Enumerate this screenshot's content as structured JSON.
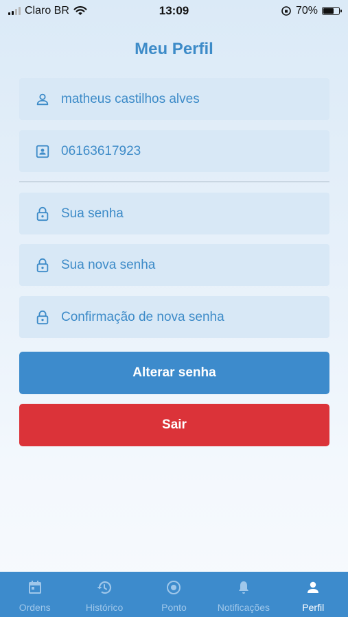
{
  "status_bar": {
    "carrier": "Claro BR",
    "time": "13:09",
    "battery_percent": "70%",
    "battery_level": 0.7
  },
  "header": {
    "title": "Meu Perfil"
  },
  "profile": {
    "name": "matheus castilhos alves",
    "document": "06163617923"
  },
  "password_form": {
    "current_placeholder": "Sua senha",
    "new_placeholder": "Sua nova senha",
    "confirm_placeholder": "Confirmação de nova senha"
  },
  "actions": {
    "change_password": "Alterar senha",
    "logout": "Sair"
  },
  "tabs": [
    {
      "label": "Ordens",
      "icon": "calendar-icon"
    },
    {
      "label": "Histórico",
      "icon": "history-icon"
    },
    {
      "label": "Ponto",
      "icon": "target-icon"
    },
    {
      "label": "Notificações",
      "icon": "bell-icon"
    },
    {
      "label": "Perfil",
      "icon": "person-icon",
      "active": true
    }
  ],
  "colors": {
    "primary": "#3d8bcc",
    "danger": "#db3339",
    "field_bg": "#d8e8f6",
    "tab_inactive": "#9fc7ea"
  }
}
